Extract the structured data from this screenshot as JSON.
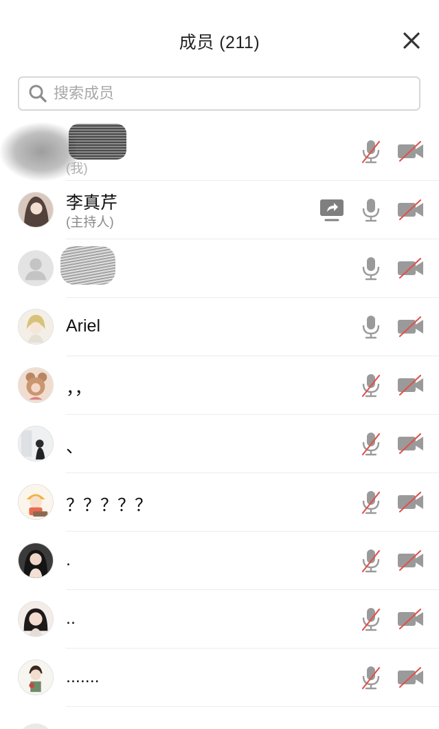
{
  "header": {
    "title": "成员 (211)"
  },
  "search": {
    "placeholder": "搜索成员",
    "value": ""
  },
  "members": [
    {
      "name": "",
      "role": "(我)",
      "mic": "muted",
      "camera": "off",
      "sharing": false,
      "redacted": true
    },
    {
      "name": "李真芹",
      "role": "(主持人)",
      "mic": "on",
      "camera": "off",
      "sharing": true
    },
    {
      "name": "",
      "role": "",
      "mic": "on",
      "camera": "off",
      "sharing": false,
      "redacted": true
    },
    {
      "name": "Ariel",
      "role": "",
      "mic": "on",
      "camera": "off",
      "sharing": false
    },
    {
      "name": "，，",
      "role": "",
      "mic": "muted",
      "camera": "off",
      "sharing": false
    },
    {
      "name": "、",
      "role": "",
      "mic": "muted",
      "camera": "off",
      "sharing": false
    },
    {
      "name": "？？？？？",
      "role": "",
      "mic": "muted",
      "camera": "off",
      "sharing": false
    },
    {
      "name": ".",
      "role": "",
      "mic": "muted",
      "camera": "off",
      "sharing": false
    },
    {
      "name": "..",
      "role": "",
      "mic": "muted",
      "camera": "off",
      "sharing": false
    },
    {
      "name": ".......",
      "role": "",
      "mic": "muted",
      "camera": "off",
      "sharing": false
    }
  ],
  "icons": {
    "close": "close-icon",
    "search": "search-icon",
    "mic": "microphone-icon",
    "mic_muted": "microphone-muted-icon",
    "camera_off": "camera-off-icon",
    "share": "screen-share-icon"
  },
  "colors": {
    "icon_gray": "#9a9a9a",
    "muted_red": "#e0524d",
    "text": "#111111",
    "subtle": "#8a8a8a"
  }
}
